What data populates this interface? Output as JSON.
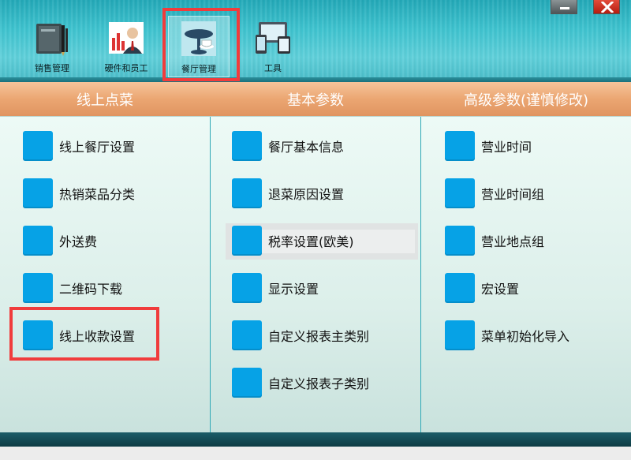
{
  "toolbar": {
    "tools": [
      {
        "label": "销售管理",
        "icon": "ledger-pen-icon"
      },
      {
        "label": "硬件和员工",
        "icon": "staff-chart-icon"
      },
      {
        "label": "餐厅管理",
        "icon": "restaurant-table-icon",
        "active": true
      },
      {
        "label": "工具",
        "icon": "devices-icon"
      }
    ],
    "minimize_icon": "minimize-icon",
    "close_icon": "close-icon"
  },
  "columns": [
    {
      "title": "线上点菜",
      "items": [
        "线上餐厅设置",
        "热销菜品分类",
        "外送费",
        "二维码下载",
        "线上收款设置"
      ]
    },
    {
      "title": "基本参数",
      "items": [
        "餐厅基本信息",
        "退菜原因设置",
        "税率设置(欧美)",
        "显示设置",
        "自定义报表主类别",
        "自定义报表子类别"
      ]
    },
    {
      "title": "高级参数(谨慎修改)",
      "items": [
        "营业时间",
        "营业时间组",
        "营业地点组",
        "宏设置",
        "菜单初始化导入"
      ]
    }
  ],
  "colors": {
    "accent_blue": "#06a2e6",
    "highlight_red": "#f03c3c",
    "header_orange": "#eba672",
    "toolbar_teal": "#3ec3cf"
  }
}
